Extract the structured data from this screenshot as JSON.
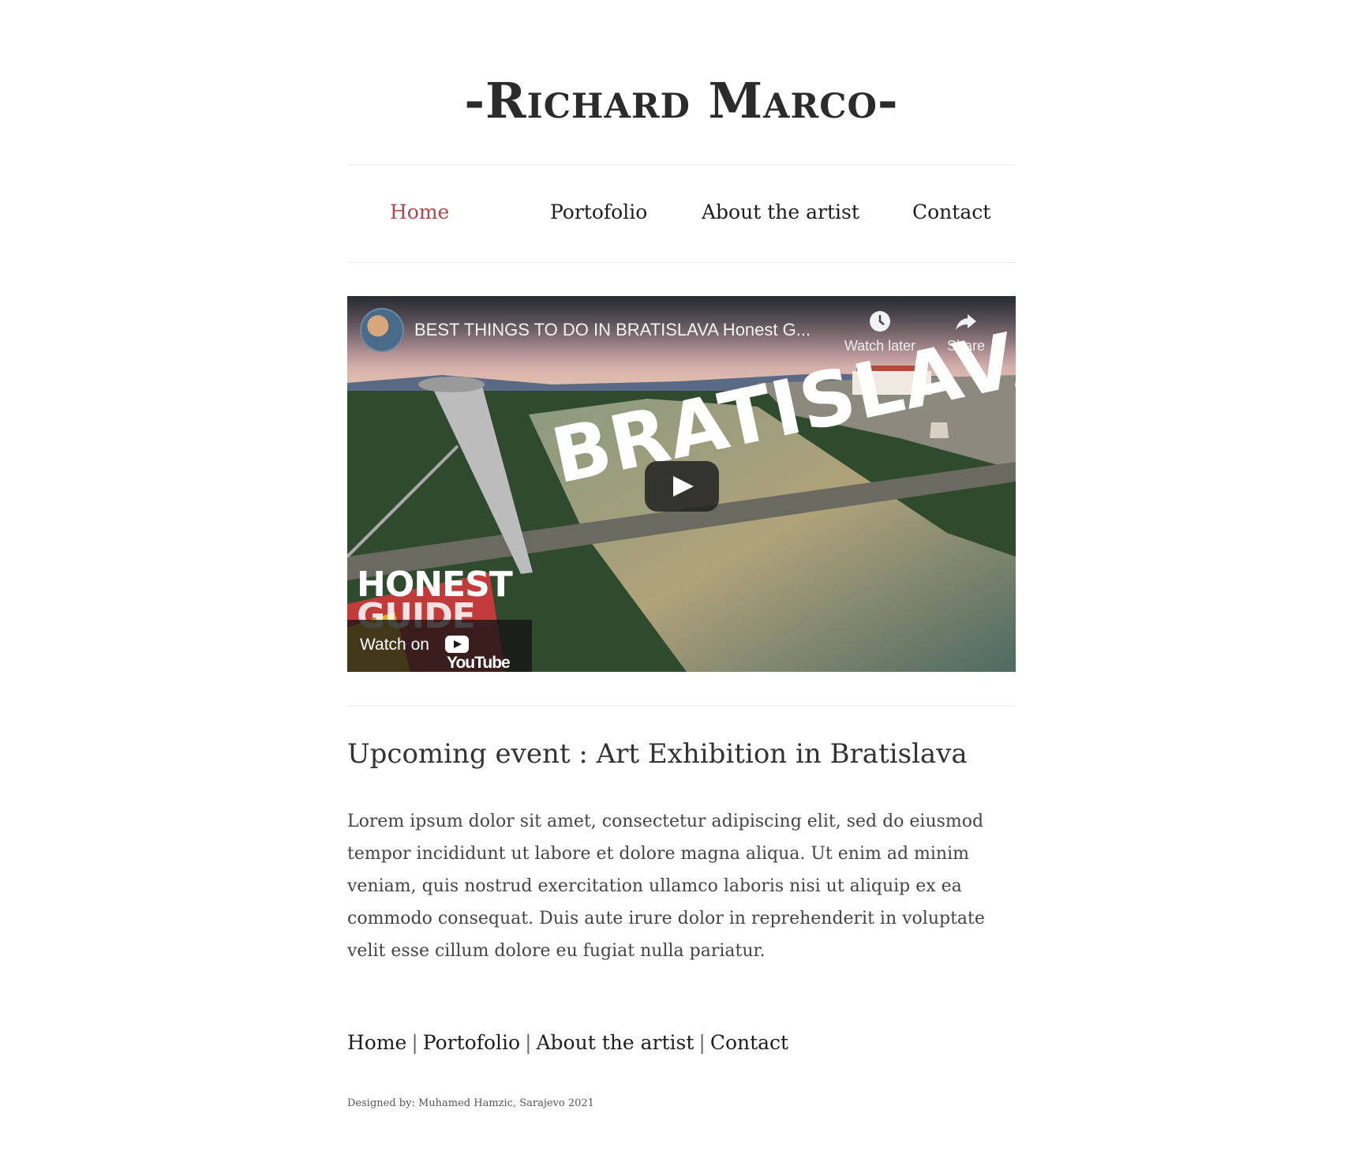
{
  "site": {
    "title": "-Richard Marco-"
  },
  "nav": {
    "items": [
      {
        "label": "Home",
        "active": true
      },
      {
        "label": "Portofolio",
        "active": false
      },
      {
        "label": "About the artist",
        "active": false
      },
      {
        "label": "Contact",
        "active": false
      }
    ]
  },
  "video": {
    "title": "BEST THINGS TO DO IN BRATISLAVA Honest G...",
    "watch_later_label": "Watch later",
    "share_label": "Share",
    "overlay_text": "BRATISLAVA",
    "corner_text_1": "HONEST",
    "corner_text_2": "GUIDE",
    "watch_on_label": "Watch on",
    "youtube_label": "YouTube",
    "icons": {
      "watch_later": "clock-icon",
      "share": "share-arrow-icon",
      "play": "play-icon"
    }
  },
  "event": {
    "title": "Upcoming event : Art Exhibition in Bratislava",
    "body": "Lorem ipsum dolor sit amet, consectetur adipiscing elit, sed do eiusmod tempor incididunt ut labore et dolore magna aliqua. Ut enim ad minim veniam, quis nostrud exercitation ullamco laboris nisi ut aliquip ex ea commodo consequat. Duis aute irure dolor in reprehenderit in voluptate velit esse cillum dolore eu fugiat nulla pariatur."
  },
  "footer": {
    "links": [
      "Home",
      "Portofolio",
      "About the artist",
      "Contact"
    ],
    "separator": "|",
    "credit": "Designed by: Muhamed Hamzic, Sarajevo 2021"
  },
  "colors": {
    "accent": "#b2454b",
    "text": "#333333",
    "rule": "#ebebeb"
  }
}
